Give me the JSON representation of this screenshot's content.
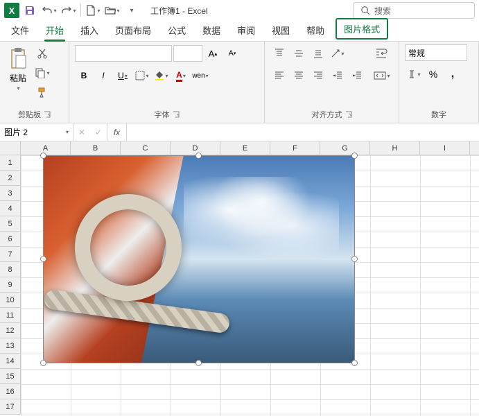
{
  "app": {
    "name": "Excel",
    "icon_letter": "X",
    "doc_title": "工作簿1 - Excel"
  },
  "search": {
    "placeholder": "搜索"
  },
  "tabs": {
    "items": [
      "文件",
      "开始",
      "插入",
      "页面布局",
      "公式",
      "数据",
      "审阅",
      "视图",
      "帮助"
    ],
    "contextual": "图片格式",
    "active_index": 1
  },
  "ribbon": {
    "clipboard": {
      "paste": "粘贴",
      "label": "剪贴板"
    },
    "font": {
      "label": "字体",
      "bold": "B",
      "italic": "I",
      "underline": "U",
      "wen": "wen"
    },
    "alignment": {
      "label": "对齐方式"
    },
    "number": {
      "label": "数字",
      "format": "常规",
      "percent": "%"
    }
  },
  "namebox": {
    "value": "图片 2"
  },
  "formula_bar": {
    "fx": "fx",
    "cancel": "✕",
    "confirm": "✓"
  },
  "columns": [
    "A",
    "B",
    "C",
    "D",
    "E",
    "F",
    "G",
    "H",
    "I"
  ],
  "rows": [
    "1",
    "2",
    "3",
    "4",
    "5",
    "6",
    "7",
    "8",
    "9",
    "10",
    "11",
    "12",
    "13",
    "14",
    "15",
    "16",
    "17"
  ],
  "embedded_object": {
    "name": "图片 2",
    "type": "image",
    "description": "sailboat deck with rope knot, sky and water"
  }
}
